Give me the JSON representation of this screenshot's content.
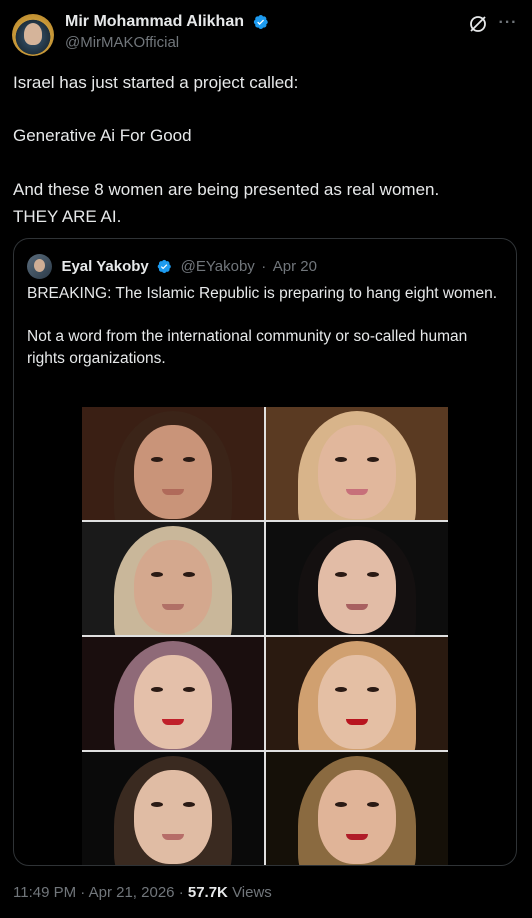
{
  "tweet": {
    "author": {
      "display_name": "Mir Mohammad Alikhan",
      "handle": "@MirMAKOfficial",
      "verified": true
    },
    "text": "Israel has just started a project called:\n\nGenerative Ai For Good\n\nAnd these 8 women are being presented as real women.\nTHEY ARE AI.",
    "icons": {
      "grok": "grok-icon",
      "more": "more-options-icon",
      "verified": "verified-badge-icon"
    },
    "accent_color": "#1d9bf0"
  },
  "quoted_tweet": {
    "author": {
      "display_name": "Eyal Yakoby",
      "handle": "@EYakoby",
      "date": "Apr 20",
      "verified": true
    },
    "text": "BREAKING: The Islamic Republic is preparing to hang eight women.\n\nNot a word from the international community or so-called human rights organizations.",
    "image": {
      "description": "photo collage of eight women",
      "photos": [
        {
          "name": "photo-1",
          "bg": "#3a1f14",
          "hair": "#3b2418",
          "skin": "#c99479",
          "lips": "#b06a5a"
        },
        {
          "name": "photo-2",
          "bg": "#5a3a22",
          "hair": "#d8b48a",
          "skin": "#e1b79c",
          "lips": "#c7707a"
        },
        {
          "name": "photo-3",
          "bg": "#1a1a1a",
          "hair": "#c9b79a",
          "skin": "#d4a88e",
          "lips": "#b07066"
        },
        {
          "name": "photo-4",
          "bg": "#0d0d0d",
          "hair": "#141010",
          "skin": "#e2bca6",
          "lips": "#a86060"
        },
        {
          "name": "photo-5",
          "bg": "#1a0e0e",
          "hair": "#8f6a78",
          "skin": "#e4c0aa",
          "lips": "#c0202a"
        },
        {
          "name": "photo-6",
          "bg": "#2a1a10",
          "hair": "#d0a070",
          "skin": "#e4bfa4",
          "lips": "#b8141e"
        },
        {
          "name": "photo-7",
          "bg": "#0a0a0a",
          "hair": "#3a2a20",
          "skin": "#e0bca4",
          "lips": "#b66d68"
        },
        {
          "name": "photo-8",
          "bg": "#151008",
          "hair": "#8a6a40",
          "skin": "#e0b498",
          "lips": "#b01c28"
        }
      ]
    }
  },
  "meta": {
    "time": "11:49 PM",
    "separator": "·",
    "date": "Apr 21, 2026",
    "views_count": "57.7K",
    "views_label": "Views"
  }
}
